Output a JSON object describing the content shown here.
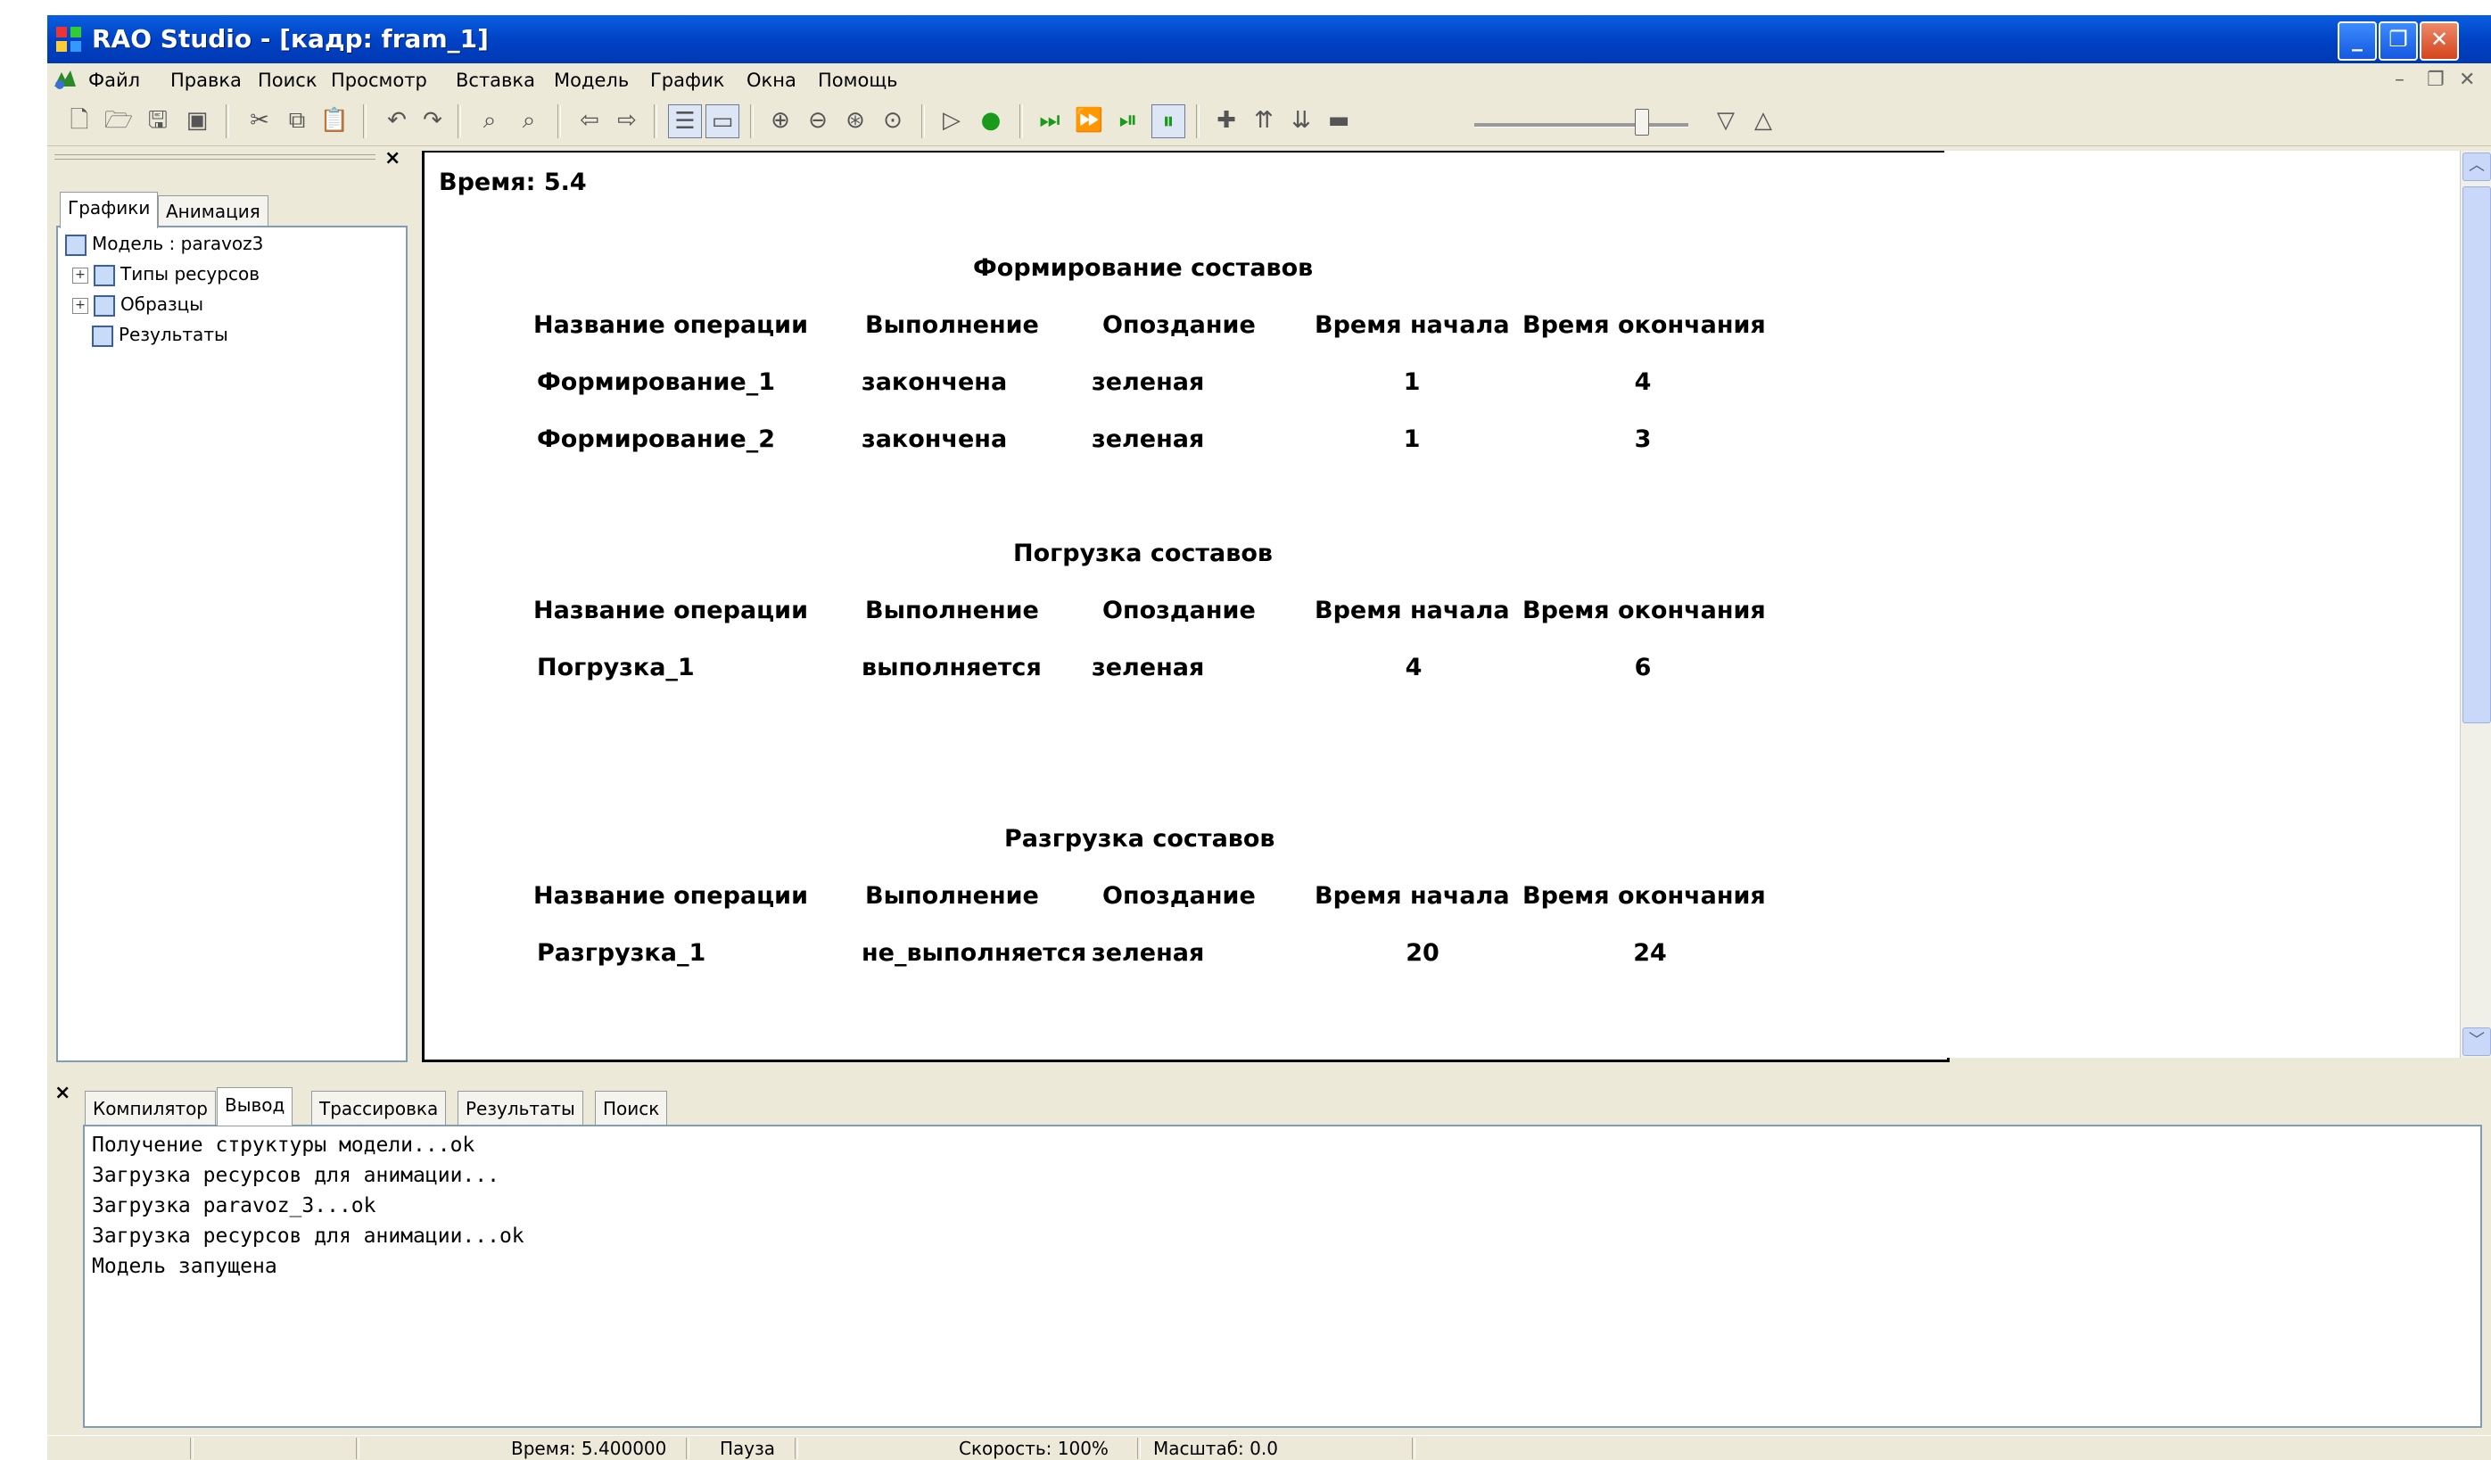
{
  "window": {
    "title": "RAO Studio - [кадр: fram_1]"
  },
  "menu": [
    "Файл",
    "Правка",
    "Поиск",
    "Просмотр",
    "Вставка",
    "Модель",
    "График",
    "Окна",
    "Помощь"
  ],
  "toolbar_icons": [
    "new-icon",
    "open-icon",
    "save-icon",
    "save-all-icon",
    "cut-icon",
    "copy-icon",
    "paste-icon",
    "undo-icon",
    "redo-icon",
    "find-icon",
    "replace-icon",
    "back-icon",
    "forward-icon",
    "tree-view-icon",
    "output-view-icon",
    "zoom-in-icon",
    "zoom-out-icon",
    "zoom-auto-icon",
    "zoom-reset-icon",
    "run-icon",
    "stop-icon",
    "speed-max-icon",
    "speed-jump-icon",
    "speed-sync-icon",
    "pause-icon",
    "add-icon",
    "step-up-icon",
    "step-down-icon",
    "minus-icon",
    "slider",
    "speed-down-icon",
    "speed-up-icon"
  ],
  "left_panel": {
    "tabs": [
      "Графики",
      "Анимация"
    ],
    "tree": {
      "root": "Модель : paravoz3",
      "children": [
        "Типы ресурсов",
        "Образцы",
        "Результаты"
      ]
    }
  },
  "frame": {
    "time_label": "Время: 5.4",
    "columns": [
      "Название операции",
      "Выполнение",
      "Опоздание",
      "Время начала",
      "Время окончания"
    ],
    "sections": [
      {
        "title": "Формирование составов",
        "rows": [
          [
            "Формирование_1",
            "закончена",
            "зеленая",
            "1",
            "4"
          ],
          [
            "Формирование_2",
            "закончена",
            "зеленая",
            "1",
            "3"
          ]
        ]
      },
      {
        "title": "Погрузка составов",
        "rows": [
          [
            "Погрузка_1",
            "выполняется",
            "зеленая",
            "4",
            "6"
          ]
        ]
      },
      {
        "title": "Разгрузка составов",
        "rows": [
          [
            "Разгрузка_1",
            "не_выполняется",
            "зеленая",
            "20",
            "24"
          ]
        ]
      }
    ]
  },
  "output": {
    "tabs": [
      "Компилятор",
      "Вывод",
      "Трассировка",
      "Результаты",
      "Поиск"
    ],
    "active_tab": "Вывод",
    "lines": [
      "Получение структуры модели...ok",
      "Загрузка ресурсов для анимации...",
      "Загрузка paravoz_3...ok",
      "Загрузка ресурсов для анимации...ok",
      "Модель запущена"
    ]
  },
  "status": {
    "time": "Время: 5.400000",
    "state": "Пауза",
    "speed": "Скорость: 100%",
    "scale": "Масштаб: 0.0"
  },
  "close_symbol": "×"
}
